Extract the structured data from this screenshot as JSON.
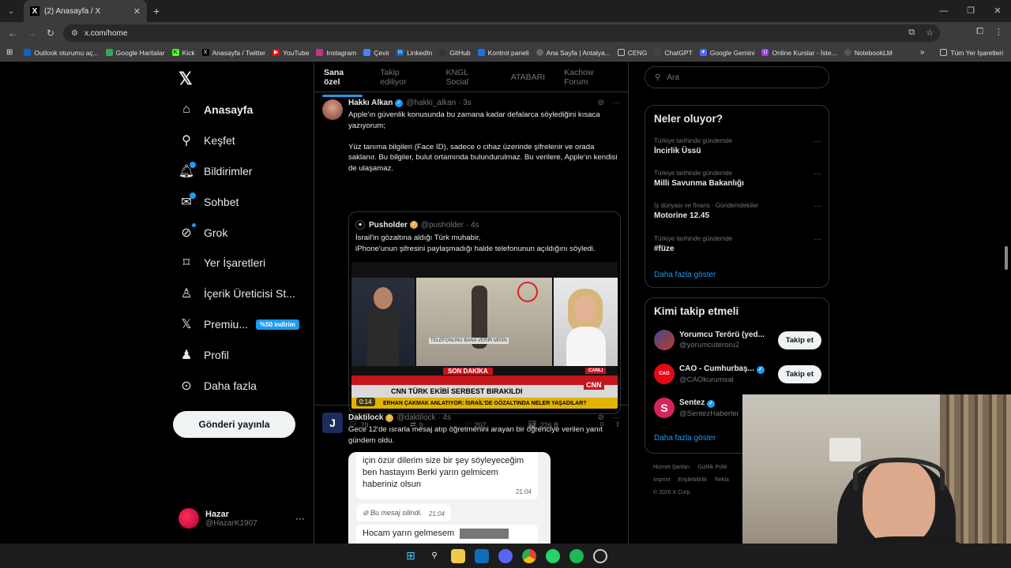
{
  "browser": {
    "tab_title": "(2) Anasayfa / X",
    "url": "x.com/home",
    "bookmarks": [
      {
        "label": "Outlook oturumu aç...",
        "color": "#0a64c9"
      },
      {
        "label": "Google Haritalar",
        "color": "#34a853"
      },
      {
        "label": "Kick",
        "color": "#53fc18"
      },
      {
        "label": "Anasayfa / Twitter",
        "color": "#000000"
      },
      {
        "label": "YouTube",
        "color": "#ff0000"
      },
      {
        "label": "Instagram",
        "color": "#c13584"
      },
      {
        "label": "Çevir",
        "color": "#4285f4"
      },
      {
        "label": "LinkedIn",
        "color": "#0a66c2"
      },
      {
        "label": "GitHub",
        "color": "#333333"
      },
      {
        "label": "Kontrol paneli",
        "color": "#1a73e8"
      },
      {
        "label": "Ana Sayfa | Antalya...",
        "color": "#666666"
      },
      {
        "label": "CENG",
        "color": "#555555"
      },
      {
        "label": "ChatGPT",
        "color": "#444444"
      },
      {
        "label": "Google Gemini",
        "color": "#4a6cf7"
      },
      {
        "label": "Online Kurslar - İste...",
        "color": "#a435f0"
      },
      {
        "label": "NotebookLM",
        "color": "#555555"
      }
    ],
    "all_bookmarks": "Tüm Yer İşaretleri"
  },
  "sidebar": {
    "items": [
      {
        "label": "Anasayfa",
        "icon": "home-icon"
      },
      {
        "label": "Keşfet",
        "icon": "search-icon"
      },
      {
        "label": "Bildirimler",
        "icon": "bell-icon"
      },
      {
        "label": "Sohbet",
        "icon": "mail-icon"
      },
      {
        "label": "Grok",
        "icon": "grok-icon"
      },
      {
        "label": "Yer İşaretleri",
        "icon": "bookmark-icon"
      },
      {
        "label": "İçerik Üreticisi St...",
        "icon": "creator-icon"
      },
      {
        "label": "Premiu...",
        "icon": "x-icon",
        "badge": "%50 indirim"
      },
      {
        "label": "Profil",
        "icon": "profile-icon"
      },
      {
        "label": "Daha fazla",
        "icon": "more-icon"
      }
    ],
    "post_button": "Gönderi yayınla",
    "user": {
      "name": "Hazar",
      "handle": "@HazarK1907"
    }
  },
  "feed": {
    "tabs": [
      "Sana özel",
      "Takip ediliyor",
      "KNGL Social",
      "ATABARI",
      "Kachow Forum"
    ],
    "tweet1": {
      "name": "Hakkı Alkan",
      "handle": "@hakki_alkan · 3s",
      "text": "Apple'ın güvenlik konusunda bu zamana kadar defalarca söylediğini kısaca yazıyorum;\n\nYüz tanıma bilgileri (Face ID), sadece o cihaz üzerinde şifrelenir ve orada saklanır. Bu bilgiler, bulut ortamında bulundurulmaz. Bu verilere, Apple'ın kendisi de ulaşamaz.",
      "quote": {
        "name": "Pusholder",
        "handle": "@pusholder · 4s",
        "text": "İsrail'in gözaltına aldığı Türk muhabir,\niPhone'unun şifresini paylaşmadığı halde telefonunun açıldığını söyledi.",
        "video": {
          "headline": "CNN TÜRK EKİBİ SERBEST BIRAKILDI",
          "sub": "ERHAN ÇAKMAK ANLATIYOR: İSRAİL'DE GÖZALTINDA NELER YAŞADILAR?",
          "breaking": "SON DAKİKA",
          "live": "CANLI",
          "time": "0:14",
          "caption": "TELEFONUNU BANA VERİR MİSİN"
        }
      },
      "stats": {
        "replies": "79",
        "reposts": "9",
        "likes": "207",
        "views": "226 B"
      }
    },
    "tweet2": {
      "name": "Daktilock",
      "handle": "@daktilock · 4s",
      "text": "Gece 12'de ısrarla mesaj atıp öğretmenini arayan bir öğrenciye verilen yanıt gündem oldu.",
      "chat": {
        "msg1": "için özür dilerim size bir şey söyleyeceğim ben hastayım Berki yarın gelmicem haberiniz olsun",
        "time1": "21:04",
        "deleted": "Bu mesaj silindi.",
        "time2": "21:04",
        "msg2": "Hocam yarın gelmesem"
      }
    }
  },
  "right": {
    "search_placeholder": "Ara",
    "trends_title": "Neler oluyor?",
    "trends": [
      {
        "category": "Türkiye tarihinde gündemde",
        "name": "İncirlik Üssü"
      },
      {
        "category": "Türkiye tarihinde gündemde",
        "name": "Milli Savunma Bakanlığı"
      },
      {
        "category": "İş dünyası ve finans · Gündemdekiler",
        "name": "Motorine 12.45"
      },
      {
        "category": "Türkiye tarihinde gündemde",
        "name": "#füze"
      }
    ],
    "show_more": "Daha fazla göster",
    "who_title": "Kimi takip etmeli",
    "who": [
      {
        "name": "Yorumcu Terörü (yed...",
        "handle": "@yorumcuteroru2",
        "follow": "Takip et"
      },
      {
        "name": "CAO - Cumhurbaş...",
        "handle": "@CAOkurumsal",
        "follow": "Takip et"
      },
      {
        "name": "Sentez",
        "handle": "@SentezHaberler",
        "follow": ""
      }
    ],
    "who_more": "Daha fazla göster",
    "footer": [
      "Hizmet Şartları",
      "Gizlilik Politi",
      "Imprint",
      "Erişilebilirlik",
      "Rekla",
      "© 2026 X Corp."
    ]
  }
}
